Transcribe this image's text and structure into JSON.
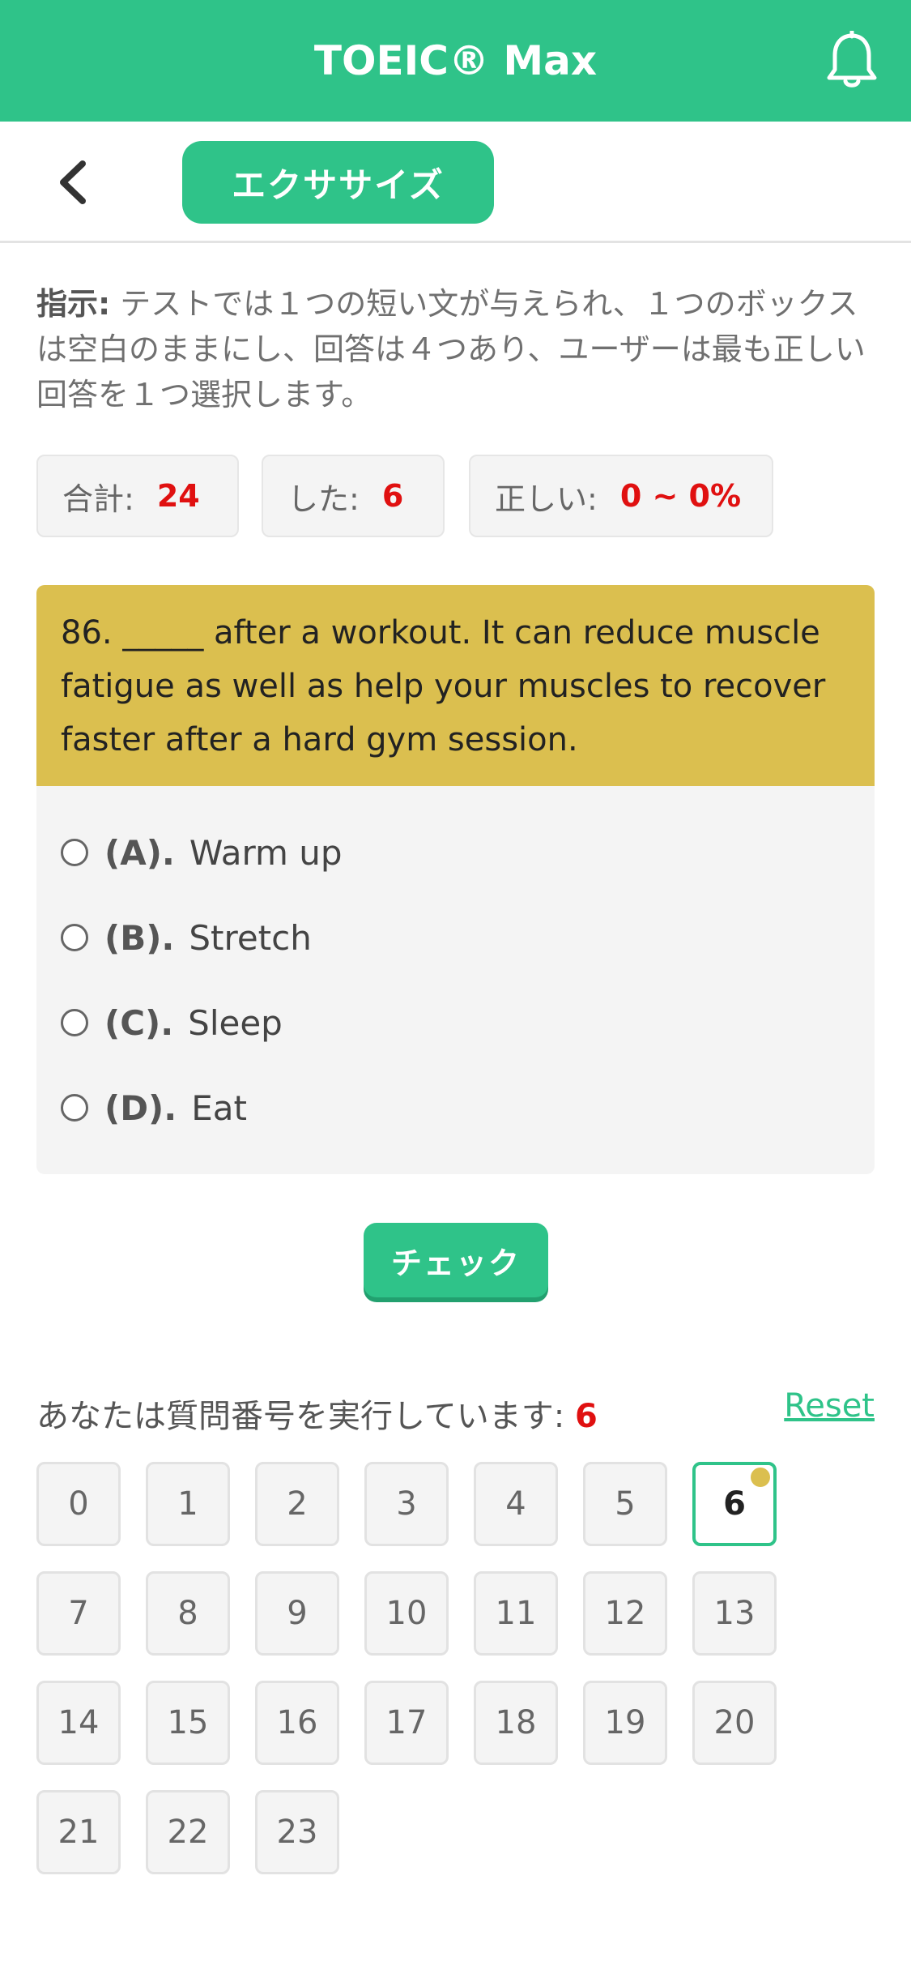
{
  "app": {
    "title": "TOEIC® Max"
  },
  "subheader": {
    "exercise_label": "エクササイズ"
  },
  "instructions": {
    "label": "指示:",
    "text": " テストでは１つの短い文が与えられ、１つのボックスは空白のままにし、回答は４つあり、ユーザーは最も正しい回答を１つ選択します。"
  },
  "stats": {
    "total_label": "合計:",
    "total_value": "24",
    "done_label": "した:",
    "done_value": "6",
    "correct_label": "正しい:",
    "correct_value": "0 ~ 0%"
  },
  "question": {
    "text": "86. _____ after a workout. It can reduce muscle fatigue as well as help your muscles to recover faster after a hard gym session.",
    "options": [
      {
        "letter": "(A).",
        "text": "Warm up"
      },
      {
        "letter": "(B).",
        "text": "Stretch"
      },
      {
        "letter": "(C).",
        "text": "Sleep"
      },
      {
        "letter": "(D).",
        "text": "Eat"
      }
    ]
  },
  "check_label": "チェック",
  "progress": {
    "label": "あなたは質問番号を実行しています:",
    "current": "6",
    "reset_label": "Reset"
  },
  "question_numbers": [
    "0",
    "1",
    "2",
    "3",
    "4",
    "5",
    "6",
    "7",
    "8",
    "9",
    "10",
    "11",
    "12",
    "13",
    "14",
    "15",
    "16",
    "17",
    "18",
    "19",
    "20",
    "21",
    "22",
    "23"
  ],
  "colors": {
    "accent": "#2fc389",
    "question_bg": "#dbbf4f",
    "value_red": "#e01010"
  }
}
